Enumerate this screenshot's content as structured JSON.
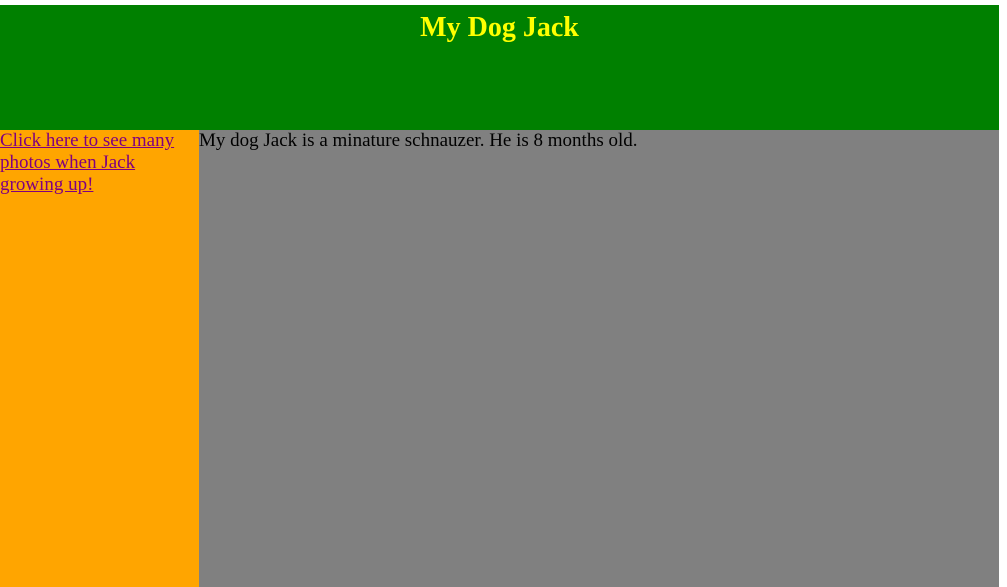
{
  "header": {
    "title": "My Dog Jack"
  },
  "sidebar": {
    "link_text": "Click here to see many photos when Jack growing up!"
  },
  "main": {
    "intro_text": "My dog Jack is a minature schnauzer. He is 8 months old."
  },
  "colors": {
    "header_bg": "#008000",
    "title_color": "#ffff00",
    "sidebar_bg": "#ffa500",
    "link_color": "#800080",
    "main_bg": "#808080"
  }
}
